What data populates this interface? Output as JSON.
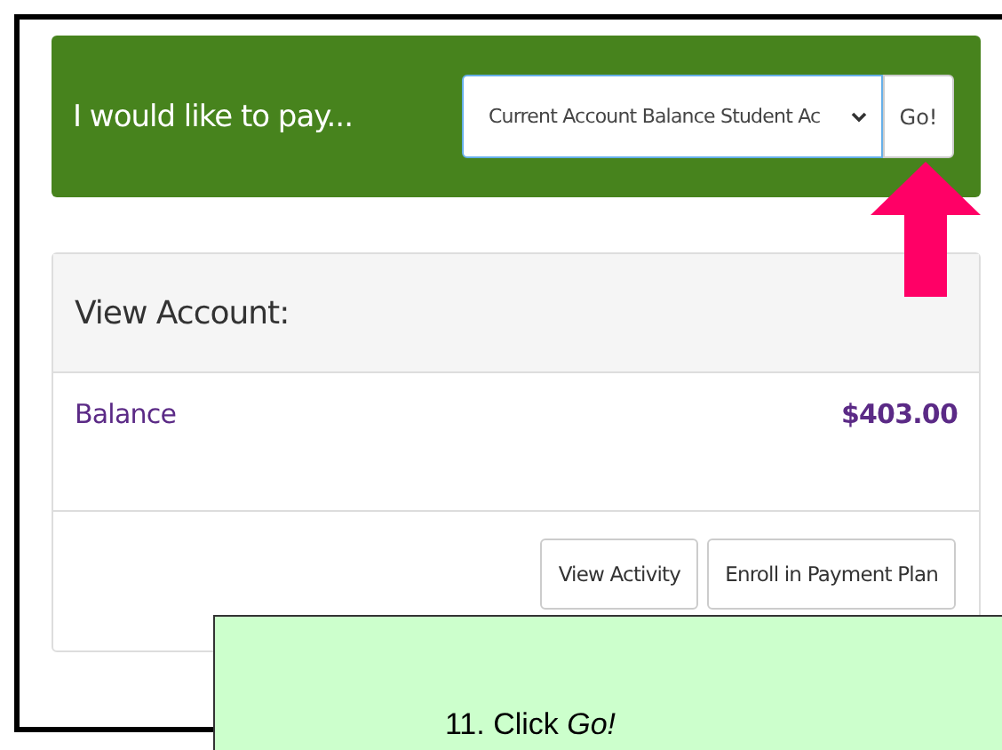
{
  "pay_bar": {
    "label": "I would like to pay...",
    "dropdown": {
      "value": "Current Account Balance Student Ac"
    },
    "go_button": "Go!"
  },
  "account_card": {
    "title": "View Account:",
    "rows": [
      {
        "label": "Balance",
        "amount": "$403.00"
      }
    ],
    "buttons": [
      "View Activity",
      "Enroll in Payment Plan"
    ]
  },
  "callout": {
    "text": "11. Click *Go!*"
  }
}
